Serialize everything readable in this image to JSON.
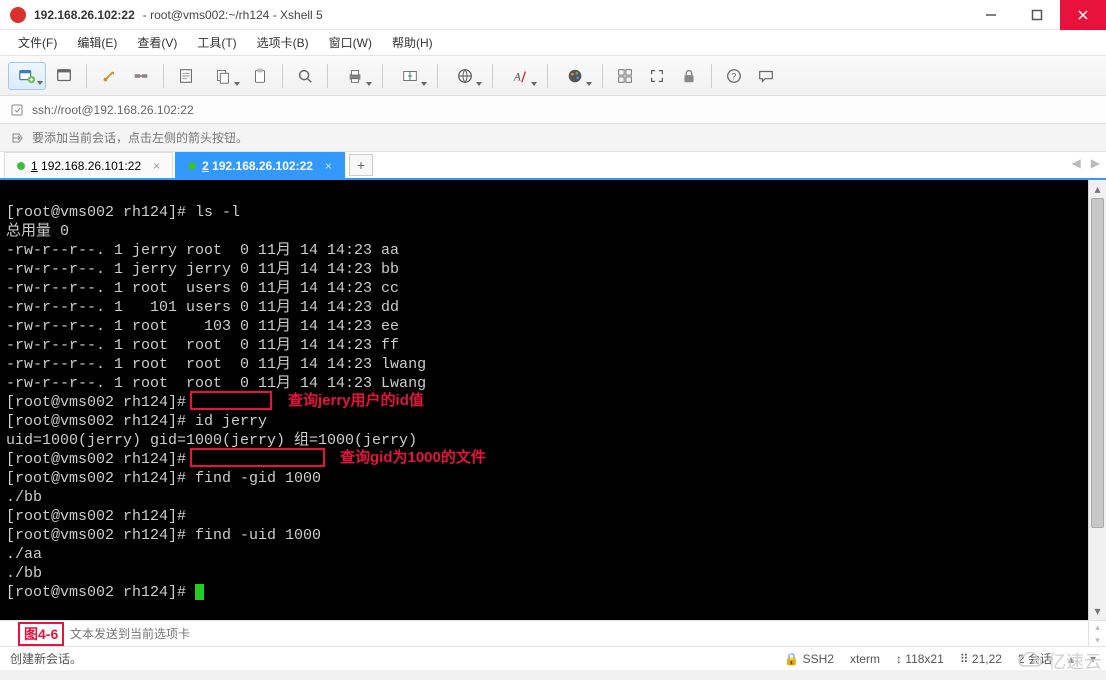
{
  "titlebar": {
    "title": "192.168.26.102:22",
    "subtitle": "root@vms002:~/rh124 - Xshell 5"
  },
  "menubar": {
    "items": [
      "文件(F)",
      "编辑(E)",
      "查看(V)",
      "工具(T)",
      "选项卡(B)",
      "窗口(W)",
      "帮助(H)"
    ]
  },
  "urlbar": {
    "url": "ssh://root@192.168.26.102:22"
  },
  "hintbar": {
    "text": "要添加当前会话，点击左侧的箭头按钮。"
  },
  "tabs": [
    {
      "label_prefix": "1",
      "label": " 192.168.26.101:22",
      "active": false
    },
    {
      "label_prefix": "2",
      "label": " 192.168.26.102:22",
      "active": true
    }
  ],
  "terminal": {
    "lines": [
      "[root@vms002 rh124]# ls -l",
      "总用量 0",
      "-rw-r--r--. 1 jerry root  0 11月 14 14:23 aa",
      "-rw-r--r--. 1 jerry jerry 0 11月 14 14:23 bb",
      "-rw-r--r--. 1 root  users 0 11月 14 14:23 cc",
      "-rw-r--r--. 1   101 users 0 11月 14 14:23 dd",
      "-rw-r--r--. 1 root    103 0 11月 14 14:23 ee",
      "-rw-r--r--. 1 root  root  0 11月 14 14:23 ff",
      "-rw-r--r--. 1 root  root  0 11月 14 14:23 lwang",
      "-rw-r--r--. 1 root  root  0 11月 14 14:23 Lwang",
      "[root@vms002 rh124]#",
      "[root@vms002 rh124]# id jerry",
      "uid=1000(jerry) gid=1000(jerry) 组=1000(jerry)",
      "[root@vms002 rh124]#",
      "[root@vms002 rh124]# find -gid 1000",
      "./bb",
      "[root@vms002 rh124]#",
      "[root@vms002 rh124]# find -uid 1000",
      "./aa",
      "./bb",
      "[root@vms002 rh124]# "
    ],
    "annotations": {
      "label1": "查询jerry用户的id值",
      "label2": "查询gid为1000的文件"
    }
  },
  "compose": {
    "placeholder": "文本发送到当前选项卡",
    "fig_label": "图4-6"
  },
  "statusbar": {
    "left": "创建新会话。",
    "ssh": "SSH2",
    "term": "xterm",
    "size": "118x21",
    "pos": "21,22",
    "sessions": "2 会话"
  },
  "watermark": {
    "text": "亿速云"
  }
}
